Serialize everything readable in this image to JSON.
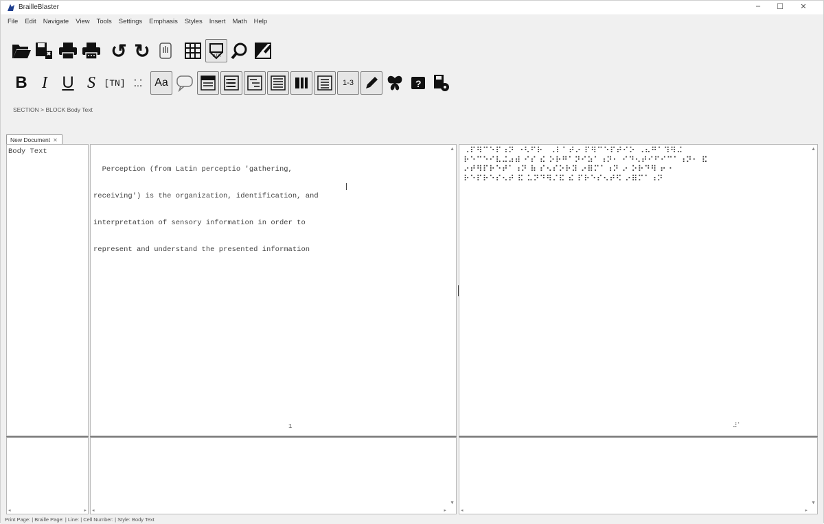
{
  "window": {
    "title": "BrailleBlaster",
    "controls": {
      "minimize": "–",
      "maximize": "☐",
      "close": "✕"
    }
  },
  "menu": [
    "File",
    "Edit",
    "Navigate",
    "View",
    "Tools",
    "Settings",
    "Emphasis",
    "Styles",
    "Insert",
    "Math",
    "Help"
  ],
  "toolbar_primary": [
    {
      "name": "open-folder-icon"
    },
    {
      "name": "save-icon"
    },
    {
      "name": "print-icon"
    },
    {
      "name": "emboss-icon"
    },
    {
      "name": "undo-icon",
      "glyph": "↺"
    },
    {
      "name": "redo-icon",
      "glyph": "↻"
    },
    {
      "name": "hand-icon"
    },
    {
      "name": "table-icon"
    },
    {
      "name": "image-describer-icon"
    },
    {
      "name": "search-icon"
    },
    {
      "name": "image-icon"
    }
  ],
  "toolbar_secondary": {
    "bold": "B",
    "italic": "I",
    "underline": "U",
    "script": "S",
    "tn": "[TN]",
    "transcriber": "⁚.⁚",
    "font_attr": "Aa",
    "icons": [
      "speech-bubble-icon",
      "heading-icon",
      "list-icon",
      "list-level-icon",
      "list-multi-icon",
      "table-editor-icon",
      "list-block-icon",
      "page-number-icon",
      "edit-icon",
      "butterfly-icon",
      "help-icon",
      "settings-icon"
    ],
    "page_number": "1-3"
  },
  "breadcrumb": "SECTION  >  BLOCK Body Text",
  "tab": {
    "label": "New Document",
    "close": "✕"
  },
  "style_pane": {
    "label": "Body Text"
  },
  "print_pane": {
    "lines": [
      "  Perception (from Latin perceptio 'gathering,",
      "receiving') is the organization, identification, and",
      "interpretation of sensory information in order to",
      "represent and understand the presented information"
    ],
    "page_mark": "1"
  },
  "braille_pane": {
    "lines": [
      "  ⠠⠏⠻⠉⠑⠏⠰⠝ ⠐⠣⠋⠗⠀⠠⠇⠁⠞⠔ ⠏⠻⠉⠑⠏⠞⠊⠕ ⠠⠦⠛⠁⠹⠻⠬",
      "⠗⠑⠉⠑⠊⠧⠬⠴⠾ ⠊⠎ ⠮ ⠕⠗⠛⠁⠝⠊⠵⠁⠰⠝⠂ ⠊⠙⠢⠞⠊⠋⠊⠉⠁⠰⠝⠂ ⠯",
      "⠔⠞⠻⠏⠗⠑⠞⠁⠰⠝ ⠷ ⠎⠢⠎⠕⠗⠽ ⠔⠿⠍⠁⠰⠝ ⠔ ⠕⠗⠙⠻ ⠖⠐",
      "⠗⠑⠏⠗⠑⠎⠢⠞ ⠯ ⠥⠝⠙⠻⠌⠯ ⠮ ⠏⠗⠑⠎⠢⠞⠫ ⠔⠿⠍⠁⠰⠝"
    ],
    "page_mark": "⠼⠁"
  },
  "status": "Print Page:  | Braille Page:  | Line:  | Cell Number:  | Style: Body Text"
}
